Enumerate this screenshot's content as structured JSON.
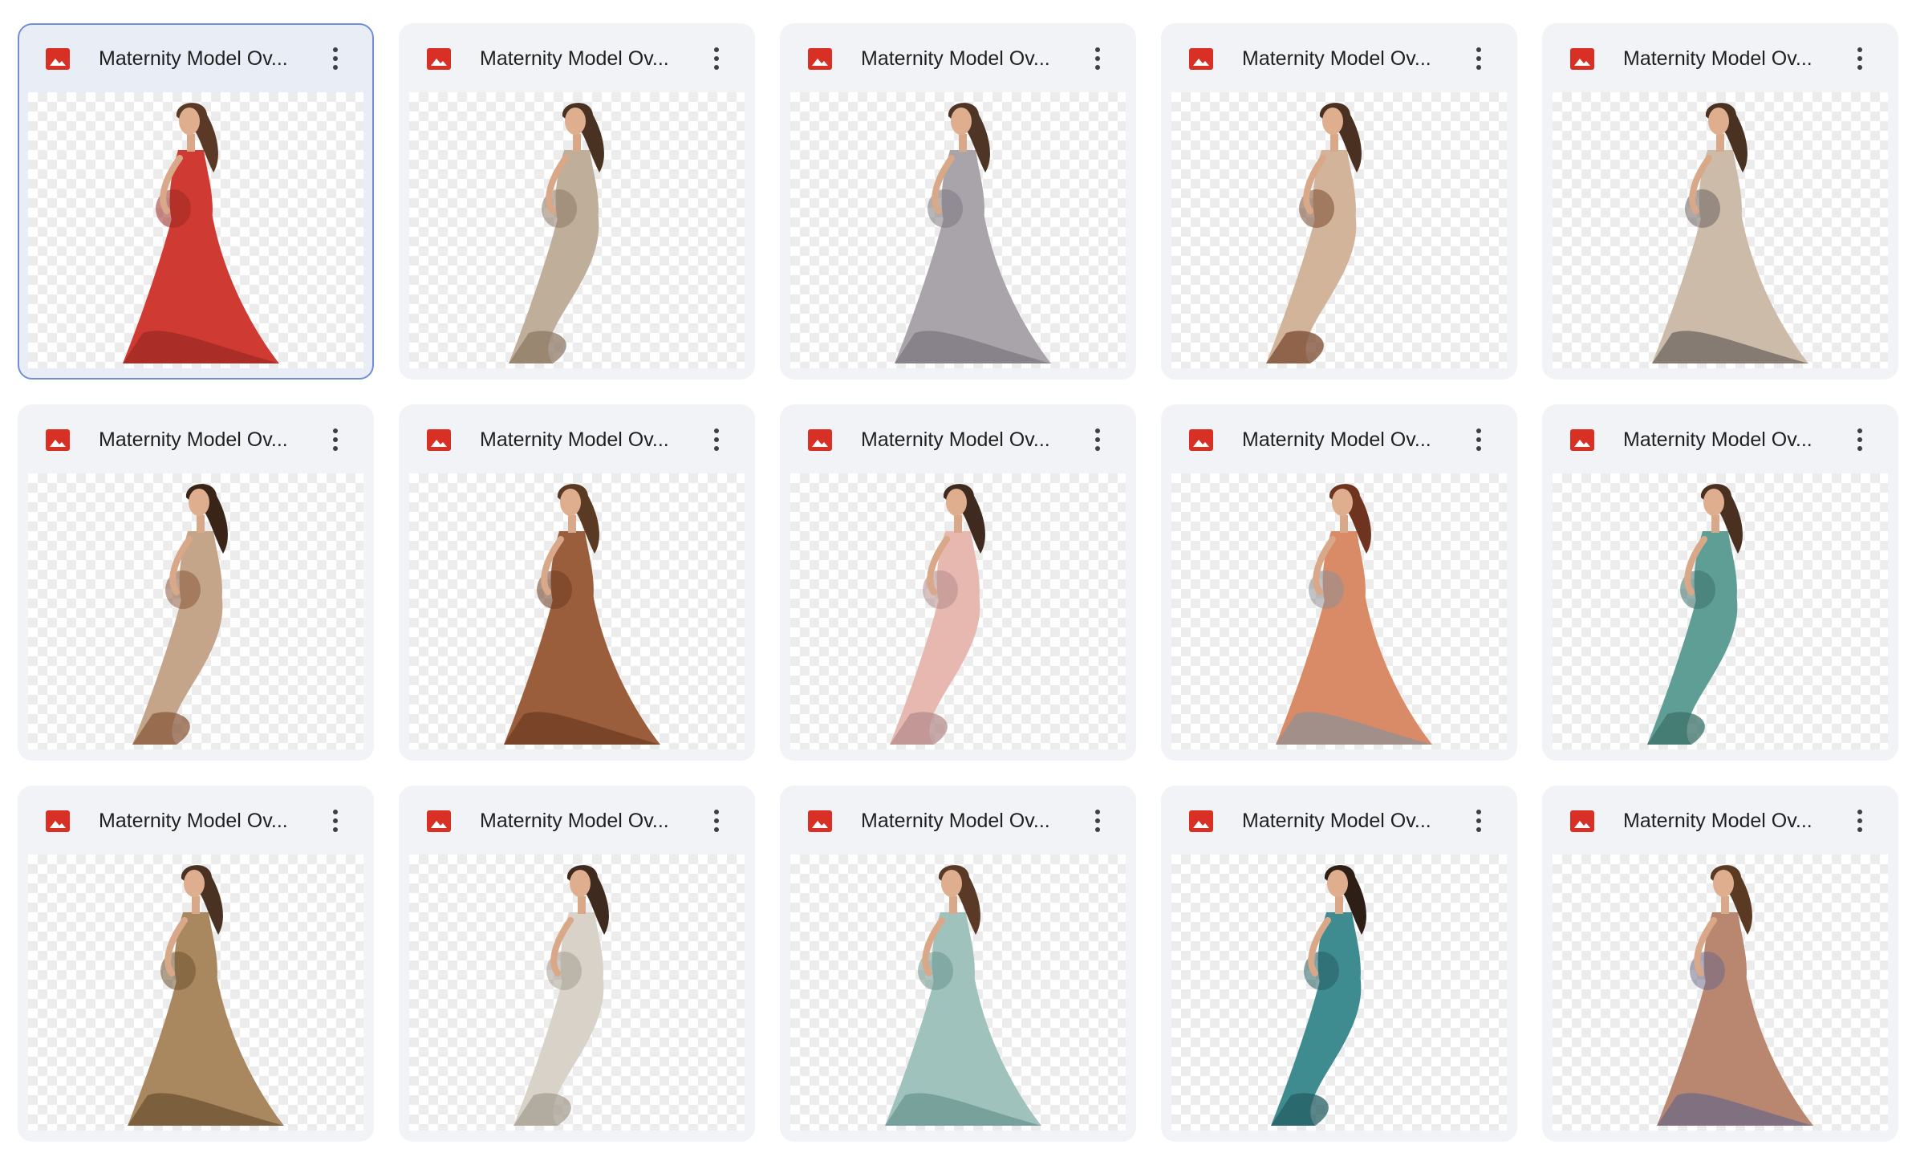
{
  "grid": {
    "files": [
      {
        "title": "Maternity Model Ov...",
        "icon": "image-file-icon",
        "dress": "#cf3b32",
        "dress_dark": "#9e2a24",
        "hair": "#5a3a26",
        "selected": true
      },
      {
        "title": "Maternity Model Ov...",
        "icon": "image-file-icon",
        "dress": "#bfae99",
        "dress_dark": "#8e7a66",
        "hair": "#4a3223"
      },
      {
        "title": "Maternity Model Ov...",
        "icon": "image-file-icon",
        "dress": "#a9a4aa",
        "dress_dark": "#7d7880",
        "hair": "#4e3526"
      },
      {
        "title": "Maternity Model Ov...",
        "icon": "image-file-icon",
        "dress": "#d2b49a",
        "dress_dark": "#7a4a30",
        "hair": "#4a3020"
      },
      {
        "title": "Maternity Model Ov...",
        "icon": "image-file-icon",
        "dress": "#cbbba8",
        "dress_dark": "#6e6560",
        "hair": "#4a3223"
      },
      {
        "title": "Maternity Model Ov...",
        "icon": "image-file-icon",
        "dress": "#c4a589",
        "dress_dark": "#8a5a3c",
        "hair": "#3a2418"
      },
      {
        "title": "Maternity Model Ov...",
        "icon": "image-file-icon",
        "dress": "#9b5e3c",
        "dress_dark": "#6e3c22",
        "hair": "#5a3a22"
      },
      {
        "title": "Maternity Model Ov...",
        "icon": "image-file-icon",
        "dress": "#e6b8b0",
        "dress_dark": "#b58c8c",
        "hair": "#3e2a1e"
      },
      {
        "title": "Maternity Model Ov...",
        "icon": "image-file-icon",
        "dress": "#d98a66",
        "dress_dark": "#8f9096",
        "hair": "#6e3420"
      },
      {
        "title": "Maternity Model Ov...",
        "icon": "image-file-icon",
        "dress": "#5f9e95",
        "dress_dark": "#3c716a",
        "hair": "#4a3020"
      },
      {
        "title": "Maternity Model Ov...",
        "icon": "image-file-icon",
        "dress": "#a98860",
        "dress_dark": "#6e5230",
        "hair": "#4a3223"
      },
      {
        "title": "Maternity Model Ov...",
        "icon": "image-file-icon",
        "dress": "#d8d2c8",
        "dress_dark": "#a59d92",
        "hair": "#3e2a1e"
      },
      {
        "title": "Maternity Model Ov...",
        "icon": "image-file-icon",
        "dress": "#9fc2bd",
        "dress_dark": "#6b9590",
        "hair": "#5a3a26"
      },
      {
        "title": "Maternity Model Ov...",
        "icon": "image-file-icon",
        "dress": "#3e8b90",
        "dress_dark": "#245e63",
        "hair": "#2e1f16"
      },
      {
        "title": "Maternity Model Ov...",
        "icon": "image-file-icon",
        "dress": "#b98670",
        "dress_dark": "#6f6a86",
        "hair": "#5a3a22"
      }
    ]
  }
}
